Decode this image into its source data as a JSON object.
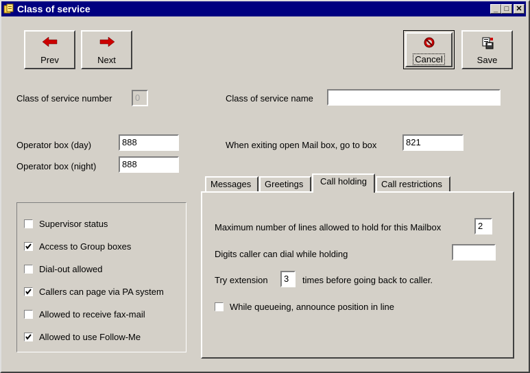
{
  "window": {
    "title": "Class of service",
    "min": "_",
    "max": "□",
    "close": "✕"
  },
  "toolbar": {
    "prev": "Prev",
    "next": "Next",
    "cancel": "Cancel",
    "save": "Save"
  },
  "form": {
    "cos_number_label": "Class of service number",
    "cos_number_value": "0",
    "cos_name_label": "Class of service name",
    "cos_name_value": "",
    "op_day_label": "Operator box (day)",
    "op_day_value": "888",
    "op_night_label": "Operator box (night)",
    "op_night_value": "888",
    "exit_label": "When exiting open Mail box, go to box",
    "exit_value": "821"
  },
  "options": [
    {
      "label": "Supervisor status",
      "checked": false
    },
    {
      "label": "Access to Group boxes",
      "checked": true
    },
    {
      "label": "Dial-out allowed",
      "checked": false
    },
    {
      "label": "Callers can page via PA system",
      "checked": true
    },
    {
      "label": "Allowed to receive fax-mail",
      "checked": false
    },
    {
      "label": "Allowed to use Follow-Me",
      "checked": true
    }
  ],
  "tabs": [
    {
      "label": "Messages"
    },
    {
      "label": "Greetings"
    },
    {
      "label": "Call holding",
      "active": true
    },
    {
      "label": "Call restrictions"
    }
  ],
  "callholding": {
    "max_lines_label": "Maximum number of lines allowed to hold for this Mailbox",
    "max_lines_value": "2",
    "digits_label": "Digits caller can dial while holding",
    "digits_value": "",
    "try_prefix": "Try extension",
    "try_value": "3",
    "try_suffix": "times before going back to caller.",
    "announce_label": "While queueing, announce position in line",
    "announce_checked": false
  },
  "colors": {
    "titlebar": "#000080",
    "face": "#d4d0c8",
    "arrow": "#cc0000"
  }
}
